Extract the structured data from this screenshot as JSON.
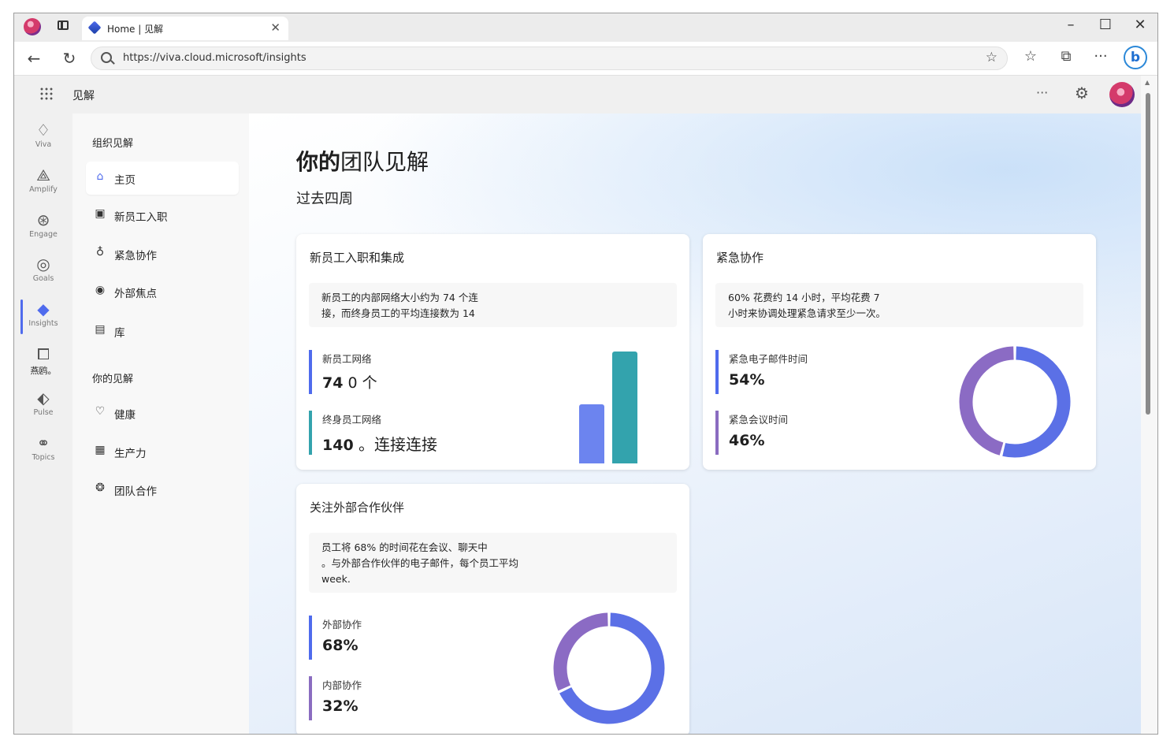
{
  "colors": {
    "accent": "#4f6bed",
    "teal": "#33a3ad",
    "purple": "#8a6cc0",
    "bar_blue": "#6c84ef",
    "donut_blue": "#5b70e6",
    "donut_purple": "#8b6bc4"
  },
  "browser": {
    "tab_title": "Home | 见解",
    "url": "https://viva.cloud.microsoft/insights"
  },
  "app": {
    "title": "见解"
  },
  "rail": [
    {
      "label": "Viva",
      "icon": "viva-icon"
    },
    {
      "label": "Amplify",
      "icon": "amplify-icon"
    },
    {
      "label": "Engage",
      "icon": "engage-icon"
    },
    {
      "label": "Goals",
      "icon": "goals-icon"
    },
    {
      "label": "Insights",
      "icon": "insights-icon"
    },
    {
      "label": "燕鸥。",
      "icon": "learning-icon"
    },
    {
      "label": "Pulse",
      "icon": "pulse-icon"
    },
    {
      "label": "Topics",
      "icon": "topics-icon"
    }
  ],
  "sidenav": {
    "org_section": "组织见解",
    "org_items": [
      {
        "label": "主页",
        "icon": "home-icon"
      },
      {
        "label": "新员工入职",
        "icon": "onboarding-icon"
      },
      {
        "label": "紧急协作",
        "icon": "flame-icon"
      },
      {
        "label": "外部焦点",
        "icon": "external-focus-icon"
      },
      {
        "label": "库",
        "icon": "library-icon"
      }
    ],
    "your_section": "你的见解",
    "your_items": [
      {
        "label": "健康",
        "icon": "heart-icon"
      },
      {
        "label": "生产力",
        "icon": "productivity-icon"
      },
      {
        "label": "团队合作",
        "icon": "teamwork-icon"
      }
    ]
  },
  "page": {
    "title_bold": "你的",
    "title_rest": "团队见解",
    "subtitle": "过去四周"
  },
  "cards": {
    "onboarding": {
      "title": "新员工入职和集成",
      "desc_line1": "新员工的内部网络大小约为 74 个连",
      "desc_line2": "接，而终身员工的平均连接数为 14",
      "m1_label": "新员工网络",
      "m1_value": "74",
      "m1_unit": " 0 个",
      "m2_label": "终身员工网络",
      "m2_value": "140",
      "m2_unit": " 。连接连接",
      "bars": [
        {
          "series": "新员工网络",
          "value": 74
        },
        {
          "series": "终身员工网络",
          "value": 140
        }
      ]
    },
    "urgent": {
      "title": "紧急协作",
      "desc_line1": "60% 花费约 14 小时，平均花费 7",
      "desc_line2": "小时来协调处理紧急请求至少一次。",
      "m1_label": "紧急电子邮件时间",
      "m1_value": "54%",
      "m2_label": "紧急会议时间",
      "m2_value": "46%",
      "donut": [
        {
          "name": "紧急电子邮件时间",
          "value": 54
        },
        {
          "name": "紧急会议时间",
          "value": 46
        }
      ]
    },
    "external": {
      "title": "关注外部合作伙伴",
      "desc_line1": "员工将 68% 的时间花在会议、聊天中",
      "desc_line2": "。与外部合作伙伴的电子邮件，每个员工平均",
      "desc_line3": "week.",
      "m1_label": "外部协作",
      "m1_value": "68%",
      "m2_label": "内部协作",
      "m2_value": "32%",
      "donut": [
        {
          "name": "外部协作",
          "value": 68
        },
        {
          "name": "内部协作",
          "value": 32
        }
      ]
    }
  }
}
